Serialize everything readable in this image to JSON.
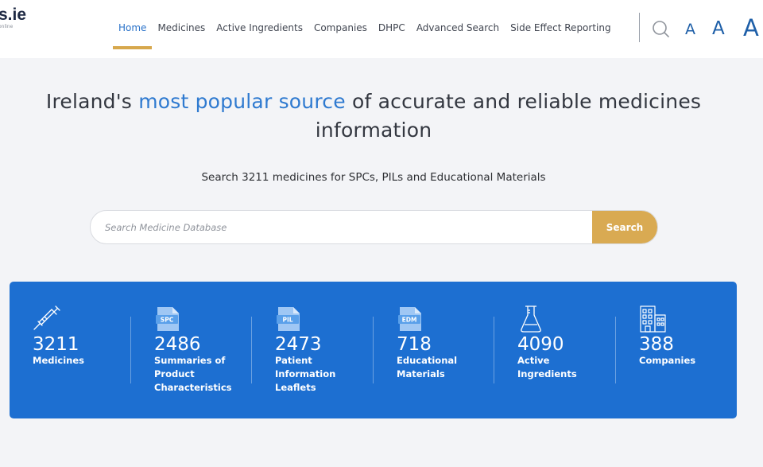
{
  "site": {
    "logo_text": "s.ie",
    "logo_subtext": "online"
  },
  "nav": {
    "items": [
      {
        "label": "Home",
        "active": true
      },
      {
        "label": "Medicines",
        "active": false
      },
      {
        "label": "Active Ingredients",
        "active": false
      },
      {
        "label": "Companies",
        "active": false
      },
      {
        "label": "DHPC",
        "active": false
      },
      {
        "label": "Advanced Search",
        "active": false
      },
      {
        "label": "Side Effect Reporting",
        "active": false
      }
    ]
  },
  "font_size_controls": {
    "small": "A",
    "medium": "A",
    "large": "A"
  },
  "hero": {
    "title_before": "Ireland's ",
    "title_highlight": "most popular source",
    "title_after": " of accurate and reliable medicines information",
    "subtitle": "Search 3211 medicines for SPCs, PILs and Educational Materials"
  },
  "search": {
    "placeholder": "Search Medicine Database",
    "value": "",
    "button_label": "Search"
  },
  "stats": [
    {
      "icon": "syringe-icon",
      "number": "3211",
      "label": "Medicines"
    },
    {
      "icon": "spc-document-icon",
      "icon_text": "SPC",
      "number": "2486",
      "label": "Summaries of Product Characteristics"
    },
    {
      "icon": "pil-document-icon",
      "icon_text": "PIL",
      "number": "2473",
      "label": "Patient Information Leaflets"
    },
    {
      "icon": "edm-document-icon",
      "icon_text": "EDM",
      "number": "718",
      "label": "Educational Materials"
    },
    {
      "icon": "flask-icon",
      "number": "4090",
      "label": "Active Ingredients"
    },
    {
      "icon": "building-icon",
      "number": "388",
      "label": "Companies"
    }
  ],
  "colors": {
    "accent_blue": "#2f7ad0",
    "panel_blue": "#1d6fd1",
    "gold": "#d9aa52",
    "background": "#f3f4f7"
  }
}
